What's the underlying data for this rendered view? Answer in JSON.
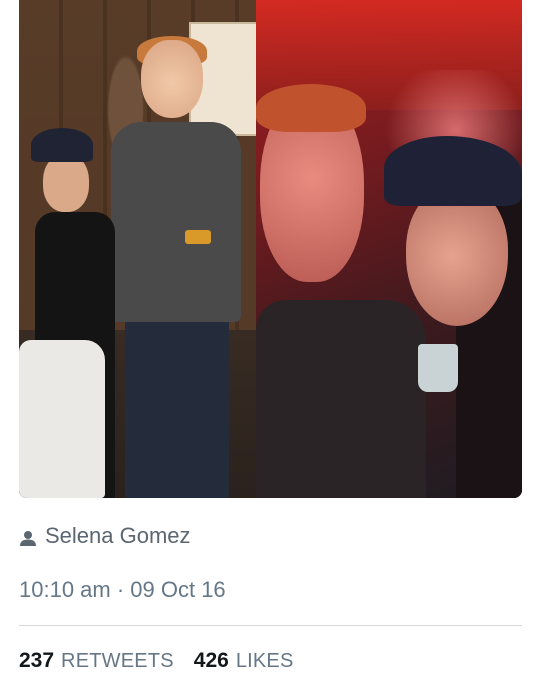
{
  "tweet": {
    "author_name": "Selena Gomez",
    "author_icon": "user-icon",
    "timestamp": "10:10 am · 09 Oct 16"
  },
  "media": {
    "photos": [
      "photo-left",
      "photo-right"
    ]
  },
  "stats": {
    "retweets_count": "237",
    "retweets_label": "RETWEETS",
    "likes_count": "426",
    "likes_label": "LIKES"
  }
}
